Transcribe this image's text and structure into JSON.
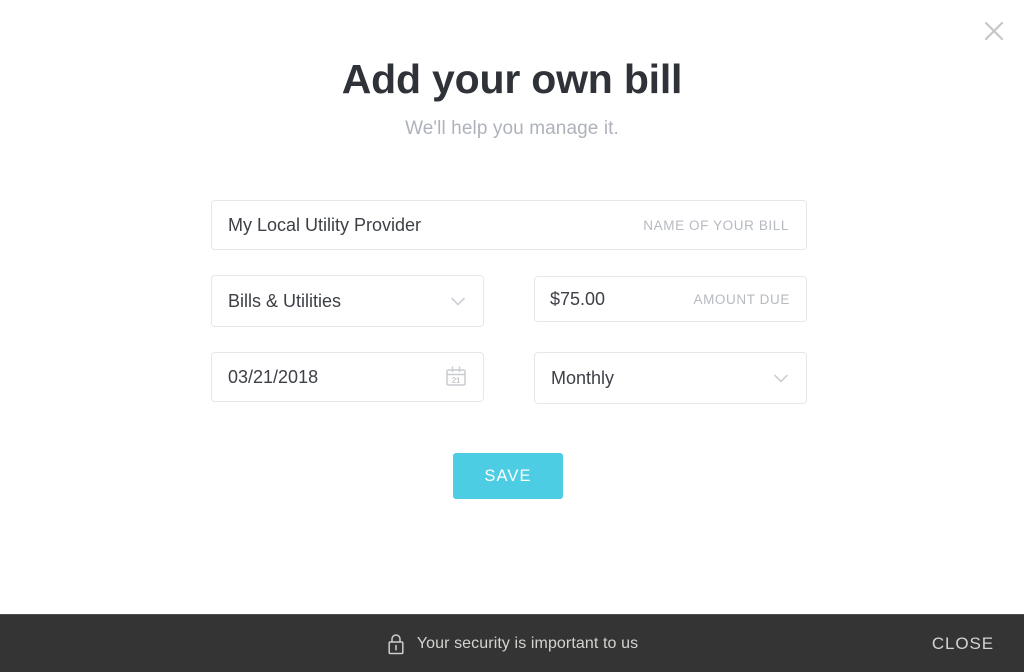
{
  "modal": {
    "title": "Add your own bill",
    "subtitle": "We'll help you manage it.",
    "close_icon": "close-x-icon"
  },
  "form": {
    "bill_name": {
      "value": "My Local Utility Provider",
      "label": "NAME OF YOUR BILL"
    },
    "category": {
      "value": "Bills & Utilities",
      "icon": "chevron-down-icon"
    },
    "amount": {
      "value": "$75.00",
      "label": "AMOUNT DUE"
    },
    "due_date": {
      "value": "03/21/2018",
      "icon": "calendar-icon",
      "icon_day": "21"
    },
    "frequency": {
      "value": "Monthly",
      "icon": "chevron-down-icon"
    }
  },
  "actions": {
    "save_label": "SAVE",
    "save_color": "#4ccde4"
  },
  "footer": {
    "security_icon": "lock-icon",
    "security_text": "Your security is important to us",
    "close_label": "CLOSE",
    "background": "#343434"
  }
}
